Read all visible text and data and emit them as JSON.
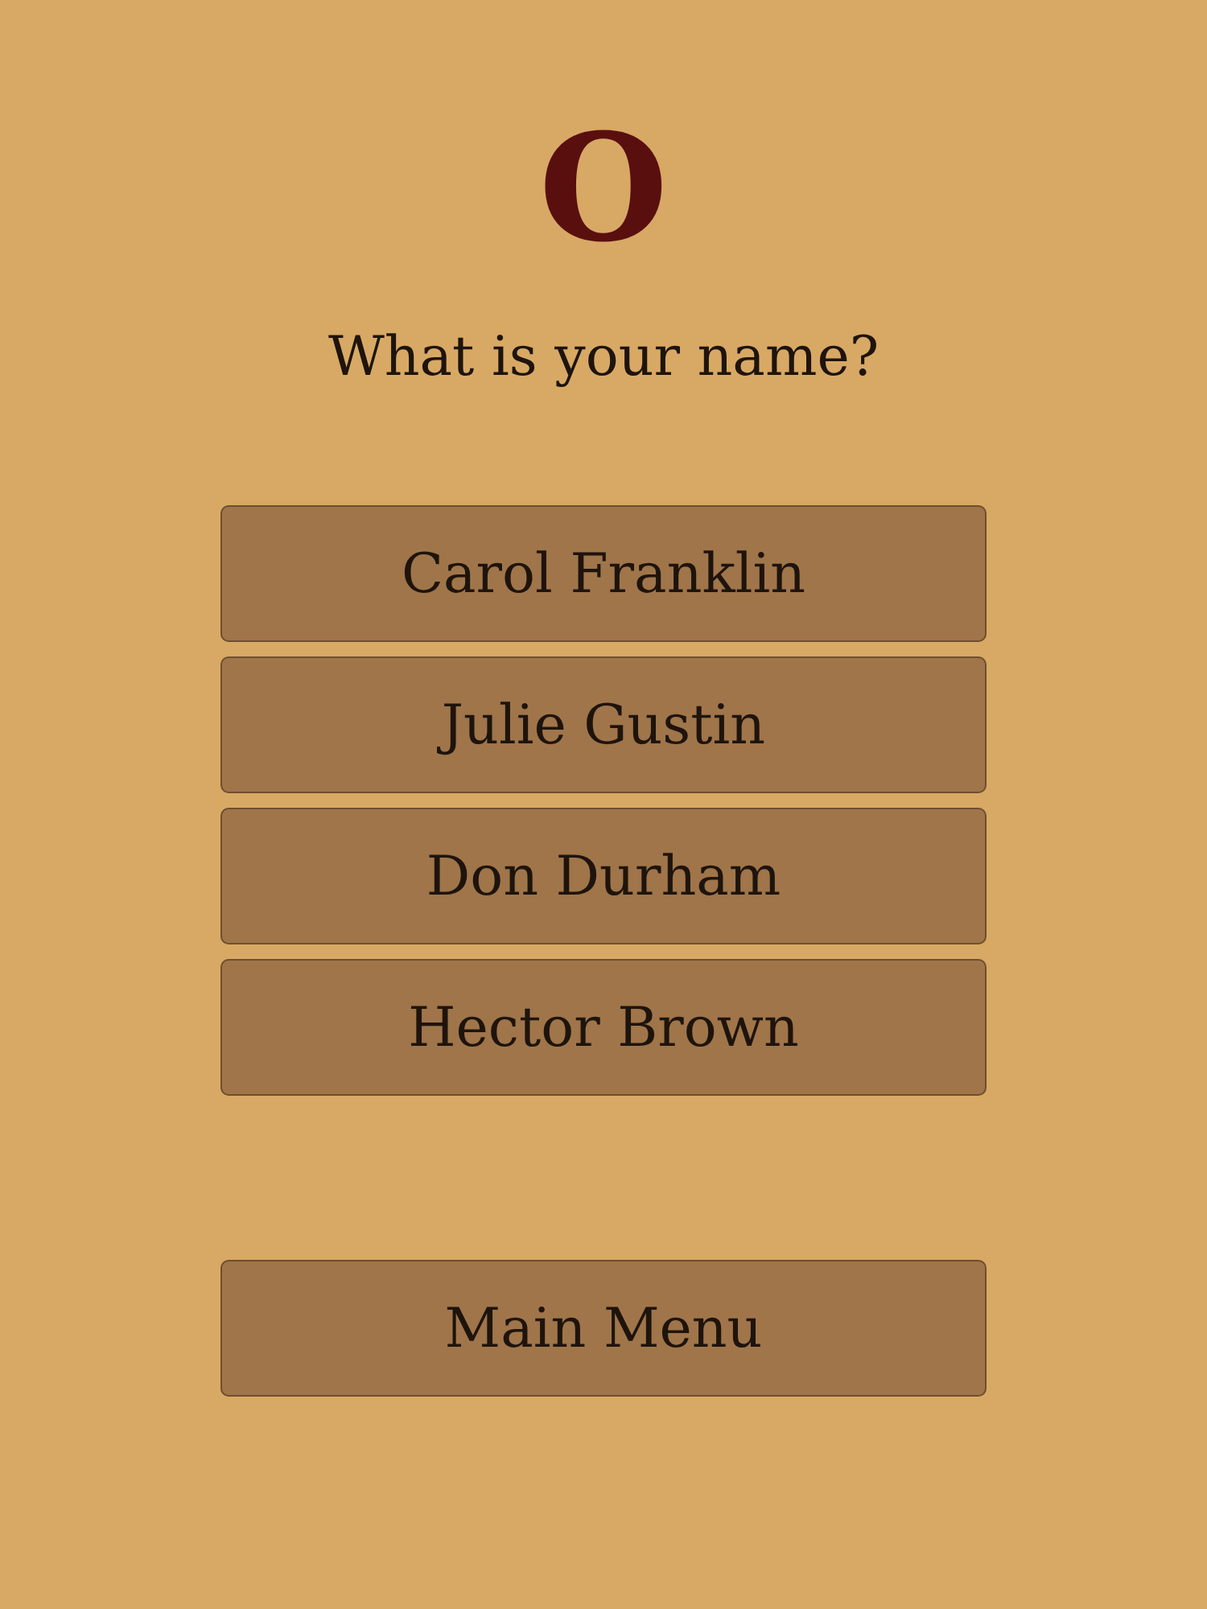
{
  "logo": "O",
  "question": "What is your name?",
  "answers": [
    {
      "label": "Carol Franklin"
    },
    {
      "label": "Julie Gustin"
    },
    {
      "label": "Don Durham"
    },
    {
      "label": "Hector Brown"
    }
  ],
  "main_menu": "Main Menu"
}
